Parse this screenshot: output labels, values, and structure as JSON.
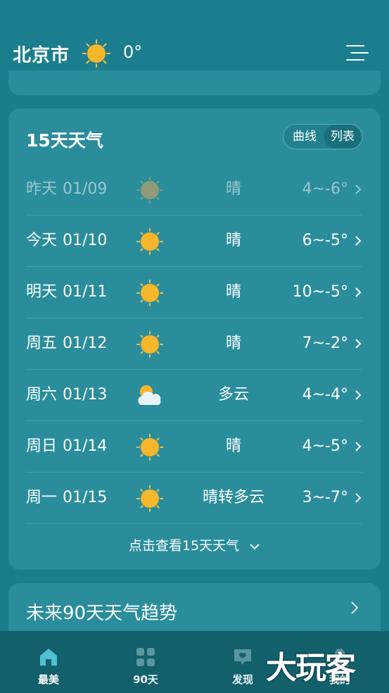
{
  "header": {
    "city": "北京市",
    "icon": "sun-icon",
    "temperature": "0°"
  },
  "forecast": {
    "title": "15天天气",
    "view_toggle": [
      "曲线",
      "列表"
    ],
    "selected_view": "列表",
    "rows": [
      {
        "day": "昨天",
        "date": "01/09",
        "icon": "sun-icon",
        "condition": "晴",
        "range": "4~-6°"
      },
      {
        "day": "今天",
        "date": "01/10",
        "icon": "sun-icon",
        "condition": "晴",
        "range": "6~-5°"
      },
      {
        "day": "明天",
        "date": "01/11",
        "icon": "sun-icon",
        "condition": "晴",
        "range": "10~-5°"
      },
      {
        "day": "周五",
        "date": "01/12",
        "icon": "sun-icon",
        "condition": "晴",
        "range": "7~-2°"
      },
      {
        "day": "周六",
        "date": "01/13",
        "icon": "cloud-sun-icon",
        "condition": "多云",
        "range": "4~-4°"
      },
      {
        "day": "周日",
        "date": "01/14",
        "icon": "sun-icon",
        "condition": "晴",
        "range": "4~-5°"
      },
      {
        "day": "周一",
        "date": "01/15",
        "icon": "sun-icon",
        "condition": "晴转多云",
        "range": "3~-7°"
      }
    ],
    "more_label": "点击查看15天天气"
  },
  "trend": {
    "title": "未来90天天气趋势"
  },
  "tabbar": {
    "items": [
      {
        "label": "最美",
        "icon": "home-icon"
      },
      {
        "label": "90天",
        "icon": "grid-icon"
      },
      {
        "label": "发现",
        "icon": "chat-icon"
      },
      {
        "label": "我的",
        "icon": "user-icon"
      }
    ]
  },
  "watermark": "大玩客",
  "colors": {
    "background": "#1a7d8c",
    "card": "#2a8d9c",
    "tabbar": "#11606c",
    "sun": "#f8b62b"
  }
}
